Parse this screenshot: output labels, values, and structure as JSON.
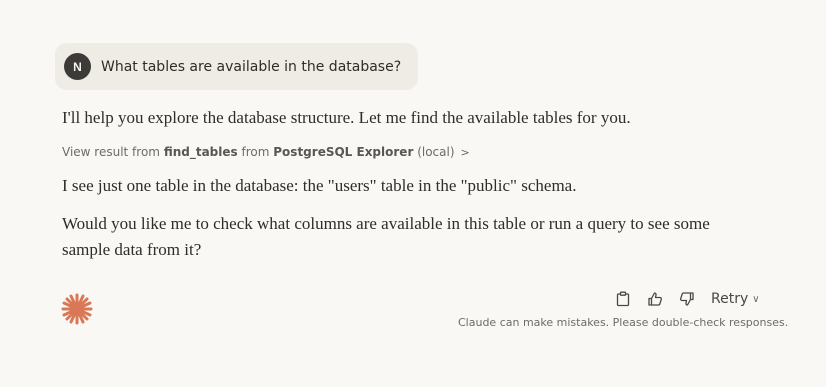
{
  "user_message": {
    "avatar_initial": "N",
    "text": "What tables are available in the database?"
  },
  "assistant_message": {
    "intro": "I'll help you explore the database structure. Let me find the available tables for you.",
    "tool_call": {
      "prefix": "View result from",
      "tool_name": "find_tables",
      "from_word": "from",
      "server_name": "PostgreSQL Explorer",
      "location": "(local)",
      "chevron": ">"
    },
    "result_text": "I see just one table in the database: the \"users\" table in the \"public\" schema.",
    "followup": "Would you like me to check what columns are available in this table or run a query to see some sample data from it?"
  },
  "actions": {
    "copy_icon": "clipboard-icon",
    "thumbs_up_icon": "thumbs-up-icon",
    "thumbs_down_icon": "thumbs-down-icon",
    "retry_label": "Retry",
    "retry_chevron": "∨"
  },
  "disclaimer": "Claude can make mistakes. Please double-check responses.",
  "colors": {
    "background": "#f9f8f5",
    "user_bubble": "#efece5",
    "avatar": "#3d3b37",
    "logo": "#d97757"
  }
}
